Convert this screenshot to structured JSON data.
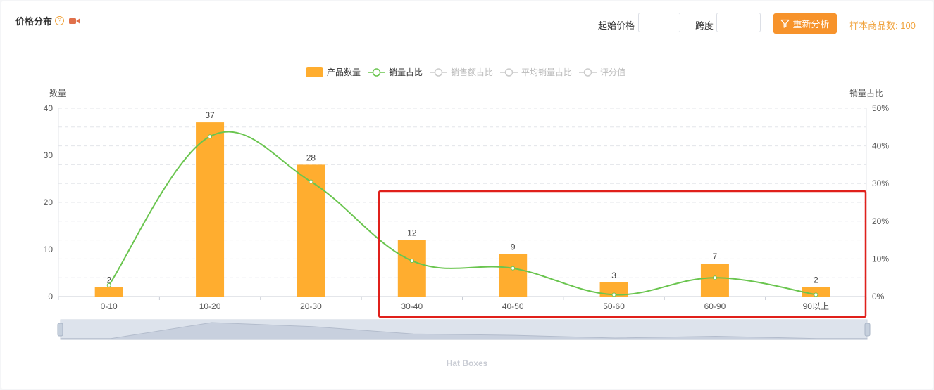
{
  "header": {
    "title": "价格分布",
    "start_price_label": "起始价格",
    "start_price_value": "",
    "span_label": "跨度",
    "span_value": "",
    "reanalyze_label": "重新分析",
    "sample_count_text": "样本商品数: 100"
  },
  "colors": {
    "accent": "#f7932b",
    "bar": "#ffad2f",
    "line": "#6ac54f",
    "highlight": "#e0201b",
    "legend_inactive": "#cccccc"
  },
  "legend": [
    {
      "name": "产品数量",
      "kind": "bar",
      "active": true
    },
    {
      "name": "销量占比",
      "kind": "line",
      "active": true
    },
    {
      "name": "销售额占比",
      "kind": "line",
      "active": false
    },
    {
      "name": "平均销量占比",
      "kind": "line",
      "active": false
    },
    {
      "name": "评分值",
      "kind": "line",
      "active": false
    }
  ],
  "chart_data": {
    "type": "bar",
    "title": "Hat Boxes",
    "categories": [
      "0-10",
      "10-20",
      "20-30",
      "30-40",
      "40-50",
      "50-60",
      "60-90",
      "90以上"
    ],
    "series": [
      {
        "name": "产品数量",
        "type": "bar",
        "axis": "left",
        "values": [
          2,
          37,
          28,
          12,
          9,
          3,
          7,
          2
        ]
      },
      {
        "name": "销量占比",
        "type": "line",
        "axis": "right",
        "values": [
          3,
          42.5,
          30.5,
          9.5,
          7.5,
          0.5,
          5,
          0.5
        ]
      }
    ],
    "ylabel": "数量",
    "ylabel_right": "销量占比",
    "ylim": [
      0,
      40
    ],
    "ylim_right": [
      0,
      50
    ],
    "yticks": [
      "0",
      "10",
      "20",
      "30",
      "40"
    ],
    "yticks_right": [
      "0%",
      "10%",
      "20%",
      "30%",
      "40%",
      "50%"
    ],
    "grid": true,
    "legend_position": "top-center"
  }
}
